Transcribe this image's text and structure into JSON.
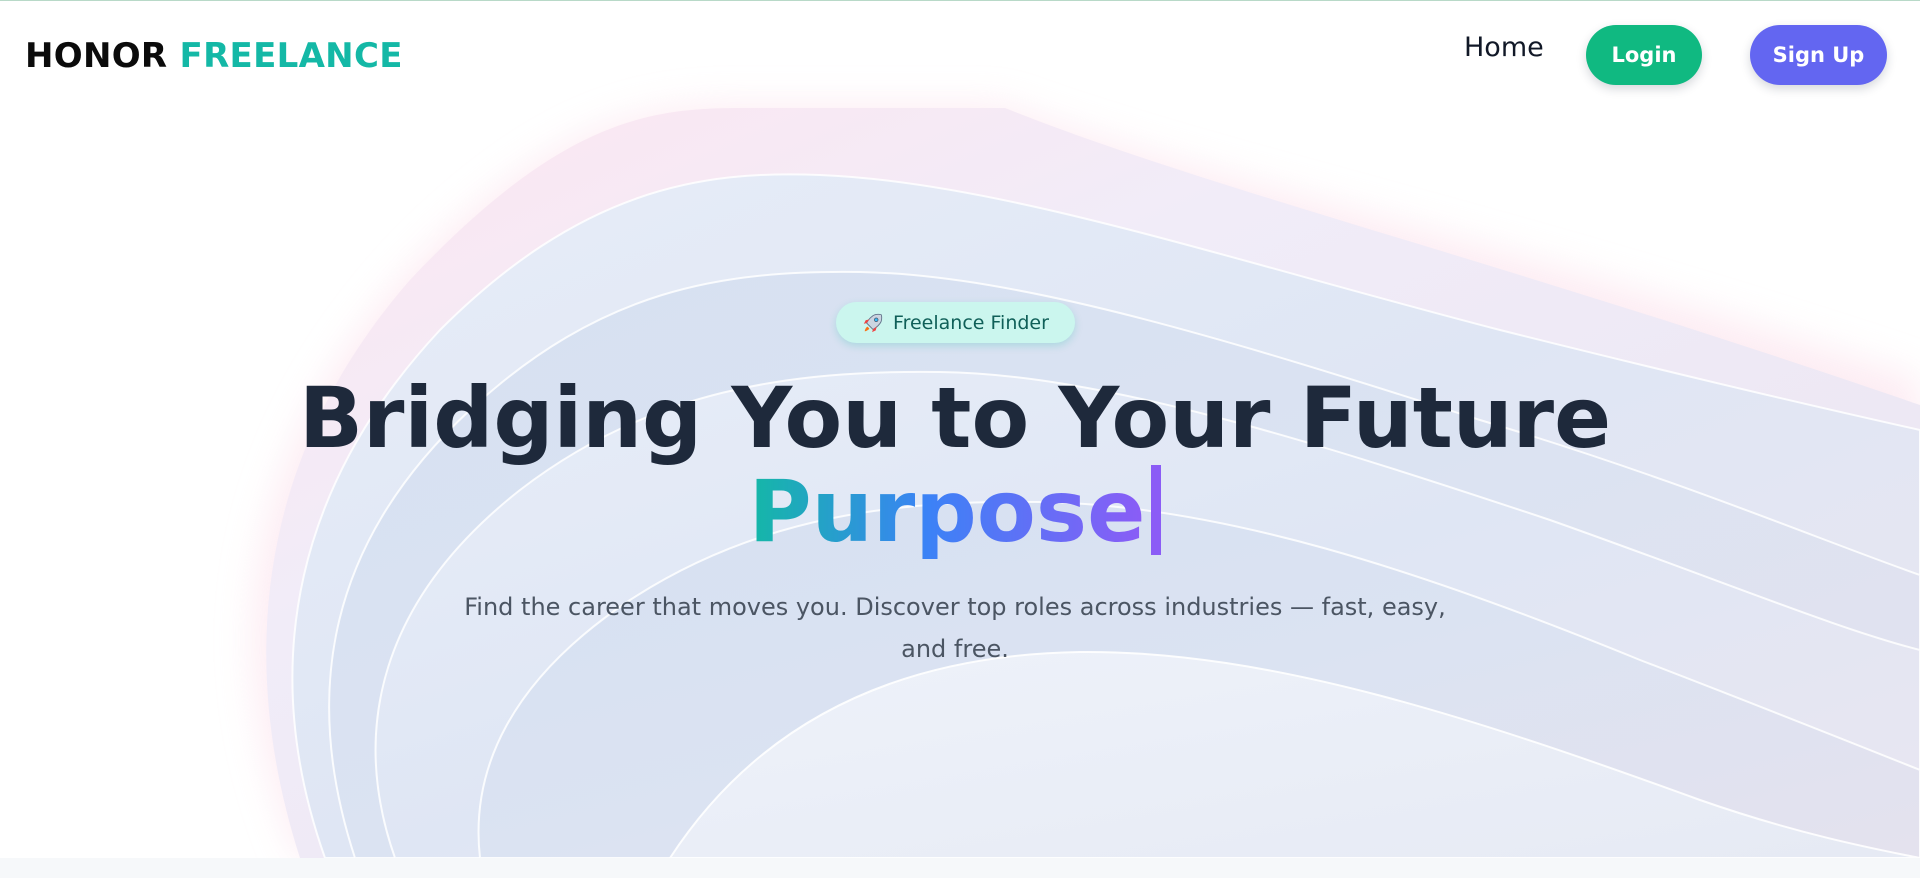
{
  "header": {
    "brand_part1": "HONOR",
    "brand_part2": "FREELANCE",
    "nav_home": "Home",
    "login_label": "Login",
    "signup_label": "Sign Up"
  },
  "hero": {
    "badge_icon": "rocket-icon",
    "badge_text": "Freelance Finder",
    "headline_line1": "Bridging You to Your Future",
    "headline_highlight": "Purpose",
    "subtitle": "Find the career that moves you. Discover top roles across industries — fast, easy, and free."
  },
  "colors": {
    "brand_teal": "#14b8a6",
    "login_green": "#10b981",
    "signup_indigo": "#6366f1",
    "headline_dark": "#1e293b",
    "gradient_start": "#14b8a6",
    "gradient_mid": "#3b82f6",
    "gradient_end": "#8b5cf6",
    "badge_bg": "#cbf6ee"
  }
}
